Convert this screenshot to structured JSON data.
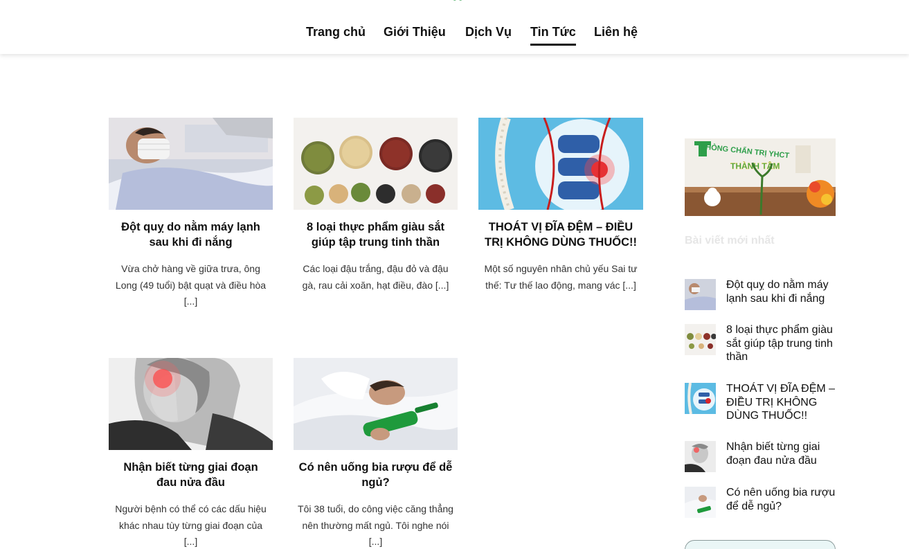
{
  "nav": {
    "items": [
      {
        "label": "Trang chủ"
      },
      {
        "label": "Giới Thiệu"
      },
      {
        "label": "Dịch Vụ"
      },
      {
        "label": "Tin Tức"
      },
      {
        "label": "Liên hệ"
      }
    ],
    "active": "Tin Tức"
  },
  "posts": [
    {
      "title": "Đột quỵ do nằm máy lạnh sau khi đi nắng",
      "excerpt": "Vừa chở hàng về giữa trưa, ông Long (49 tuổi) bật quạt và điều hòa [...]",
      "image": "patient-in-hospital-bed"
    },
    {
      "title": "8 loại thực phẩm giàu sắt giúp tập trung tinh thần",
      "excerpt": "Các loại đậu trắng, đậu đỏ và đậu gà, rau cải xoăn, hạt điều, đào [...]",
      "image": "beans-in-bowls"
    },
    {
      "title": "THOÁT VỊ ĐĨA ĐỆM – ĐIỀU TRỊ KHÔNG DÙNG THUỐC!!",
      "excerpt": "Một số nguyên nhân chủ yếu Sai tư thế: Tư thế lao động, mang vác [...]",
      "image": "spine-illustration"
    },
    {
      "title": "Nhận biết từng giai đoạn đau nửa đầu",
      "excerpt": "Người bệnh có thể có các dấu hiệu khác nhau tùy từng giai đoạn của [...]",
      "image": "woman-headache"
    },
    {
      "title": "Có nên uống bia rượu để dễ ngủ?",
      "excerpt": "Tôi 38 tuổi, do công việc căng thẳng nên thường mất ngủ. Tôi nghe nói [...]",
      "image": "man-sleeping-with-bottle"
    }
  ],
  "sidebar": {
    "banner_text": "PHÒNG CHẨN TRỊ YHCT",
    "banner_brand": "THÀNH TÂM",
    "heading": "Bài viết mới nhất",
    "recent": [
      {
        "title": "Đột quỵ do nằm máy lạnh sau khi đi nắng"
      },
      {
        "title": "8 loại thực phẩm giàu sắt giúp tập trung tinh thần"
      },
      {
        "title": "THOÁT VỊ ĐĨA ĐỆM – ĐIỀU TRỊ KHÔNG DÙNG THUỐC!!"
      },
      {
        "title": "Nhận biết từng giai đoạn đau nửa đầu"
      },
      {
        "title": "Có nên uống bia rượu để dễ ngủ?"
      }
    ]
  },
  "colors": {
    "text": "#111111",
    "brand_green": "#2e9e4a",
    "sidebar_heading": "#e6e6e6"
  }
}
